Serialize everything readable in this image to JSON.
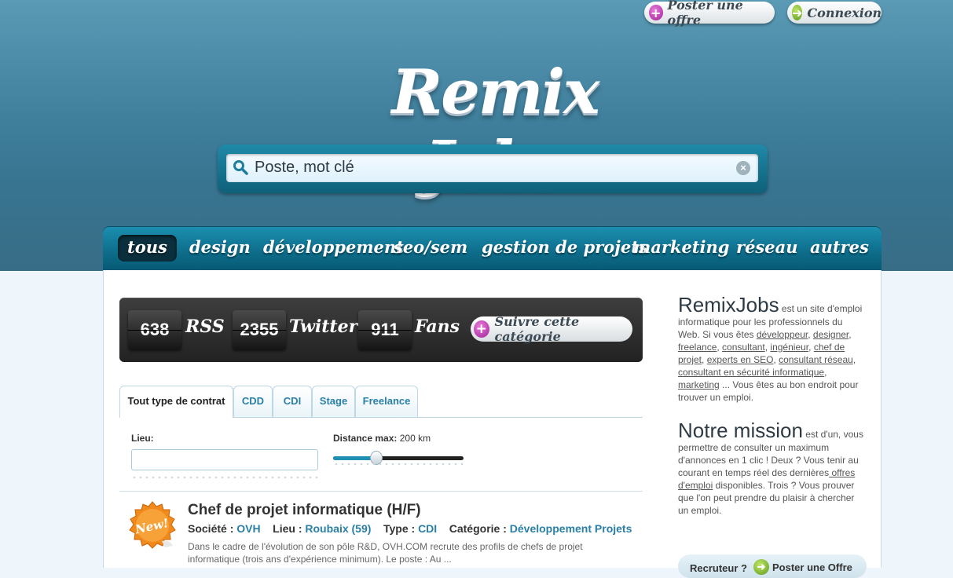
{
  "header": {
    "post_offer_label": "Poster une offre",
    "login_label": "Connexion",
    "logo_text": "Remix Jobs",
    "search_placeholder": "Poste, mot clé"
  },
  "nav": {
    "items": [
      "tous",
      "design",
      "développement",
      "seo/sem",
      "gestion de projets",
      "marketing",
      "réseau",
      "autres"
    ],
    "active": "tous"
  },
  "stats": {
    "rss_count": "638",
    "rss_label": "RSS",
    "twitter_count": "2355",
    "twitter_label": "Twitter",
    "fans_count": "911",
    "fans_label": "Fans",
    "follow_label": "Suivre cette catégorie"
  },
  "tabs": [
    "Tout type de contrat",
    "CDD",
    "CDI",
    "Stage",
    "Freelance"
  ],
  "filters": {
    "lieu_label": "Lieu:",
    "lieu_value": "",
    "distance_label": "Distance max:",
    "distance_value": "200 km",
    "distance_fraction": 0.33
  },
  "job": {
    "badge": "New!",
    "title": "Chef de projet informatique (H/F)",
    "societe_label": "Société :",
    "societe": "OVH",
    "lieu_label": "Lieu :",
    "lieu": "Roubaix (59)",
    "type_label": "Type :",
    "type": "CDI",
    "categorie_label": "Catégorie :",
    "categorie": "Développement Projets",
    "description": "Dans le cadre de l'évolution de son pôle R&D, OVH.COM recrute des profils de chefs de projet informatique (trois ans d'expérience minimum). Le poste : Au ..."
  },
  "sidebar": {
    "about_title": "RemixJobs",
    "about_intro": " est un site d'emploi informatique pour les professionnels du Web. Si vous êtes ",
    "about_links": [
      "développeur",
      "designer",
      "freelance",
      "consultant",
      "ingénieur",
      "chef de projet",
      "experts en SEO",
      "consultant réseau",
      "consultant en sécurité informatique",
      "marketing"
    ],
    "about_outro": " ... Vous êtes au bon endroit pour trouver un emploi.",
    "mission_title": "Notre mission",
    "mission_text_1": " est d'un, vous permettre de consulter un maximum d'annonces en 1 clic ! Deux ? Vous tenir au courant en temps réel des dernières",
    "mission_link": " offres d'emploi",
    "mission_text_2": " disponibles. Trois ? Vous prouver que l'on peut prendre du plaisir à chercher un emploi.",
    "recruteur_q": "Recruteur ?",
    "recruteur_btn": "Poster une Offre"
  },
  "colors": {
    "header_blue": "#3f7f9c",
    "nav_blue": "#0e6f8d",
    "link_blue": "#2a7fa6",
    "stats_bg": "#2b2b2b"
  }
}
